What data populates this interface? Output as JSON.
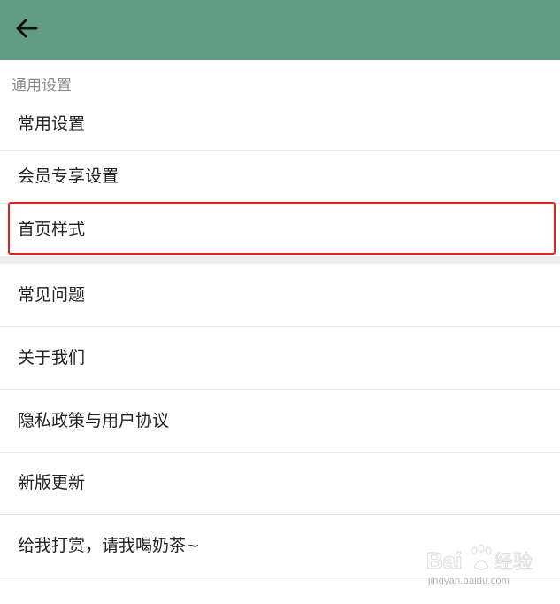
{
  "appbar": {
    "back_icon": "arrow-left-icon",
    "color": "#639c85"
  },
  "section": {
    "header": "通用设置"
  },
  "group1": [
    {
      "label": "常用设置"
    },
    {
      "label": "会员专享设置"
    },
    {
      "label": "首页样式"
    }
  ],
  "group2": [
    {
      "label": "常见问题"
    },
    {
      "label": "关于我们"
    },
    {
      "label": "隐私政策与用户协议"
    },
    {
      "label": "新版更新"
    },
    {
      "label": "给我打赏，请我喝奶茶~"
    }
  ],
  "highlight": {
    "color": "#e0241b"
  },
  "watermark": {
    "logo": "Baidu经验",
    "url": "jingyan.baidu.com"
  }
}
